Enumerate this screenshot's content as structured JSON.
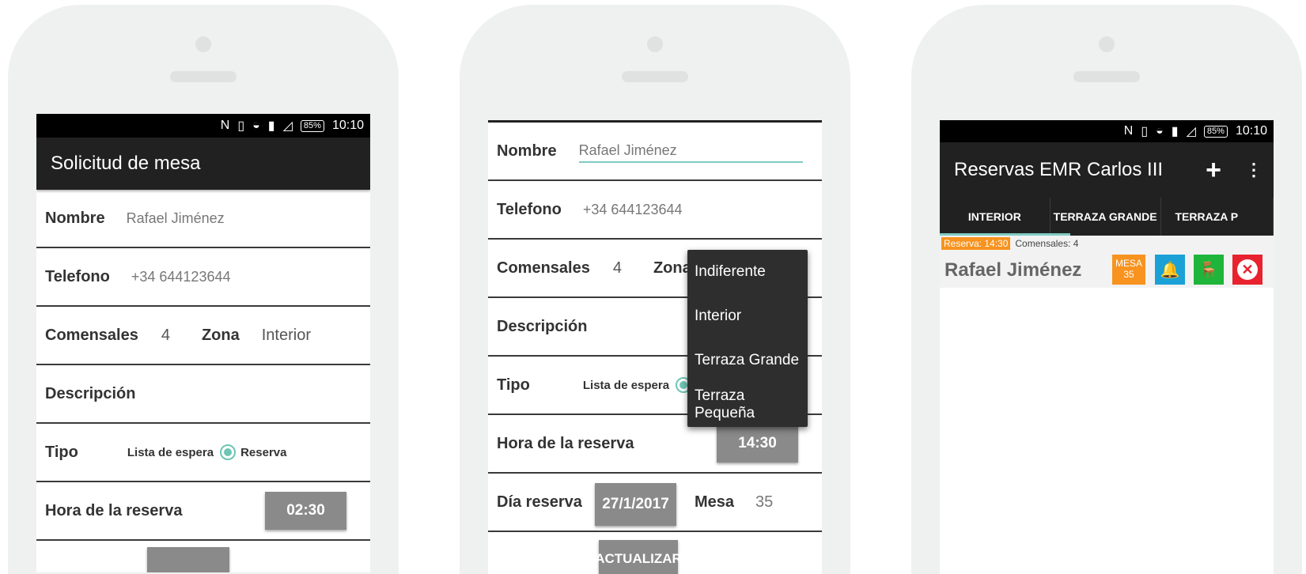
{
  "status": {
    "time": "10:10",
    "battery": "85%"
  },
  "form": {
    "title": "Solicitud de mesa",
    "nombre_label": "Nombre",
    "nombre_value": "Rafael Jiménez",
    "telefono_label": "Telefono",
    "telefono_value": "+34 644123644",
    "comensales_label": "Comensales",
    "comensales_value": "4",
    "zona_label": "Zona",
    "zona_value": "Interior",
    "descripcion_label": "Descripción",
    "tipo_label": "Tipo",
    "tipo_option_wait": "Lista de espera",
    "tipo_option_reserve": "Reserva",
    "hora_label": "Hora de la reserva",
    "hora_value_screen1": "02:30",
    "hora_value_screen2": "14:30",
    "dia_label": "Día reserva",
    "dia_value": "27/1/2017",
    "mesa_label": "Mesa",
    "mesa_value": "35",
    "update_button": "ACTUALIZAR"
  },
  "zona_dropdown": {
    "options": [
      "Indiferente",
      "Interior",
      "Terraza Grande",
      "Terraza Pequeña"
    ]
  },
  "list": {
    "title": "Reservas EMR Carlos III",
    "tabs": [
      "INTERIOR",
      "TERRAZA GRANDE",
      "TERRAZA P"
    ],
    "reservation": {
      "time_badge": "Reserva: 14:30",
      "guests": "Comensales: 4",
      "name": "Rafael Jiménez",
      "mesa_label": "MESA",
      "mesa_number": "35"
    }
  },
  "colors": {
    "accent": "#80cbc4",
    "orange": "#f7931e",
    "blue": "#1ba1d6",
    "green": "#1fb53b",
    "red": "#e8222e"
  }
}
